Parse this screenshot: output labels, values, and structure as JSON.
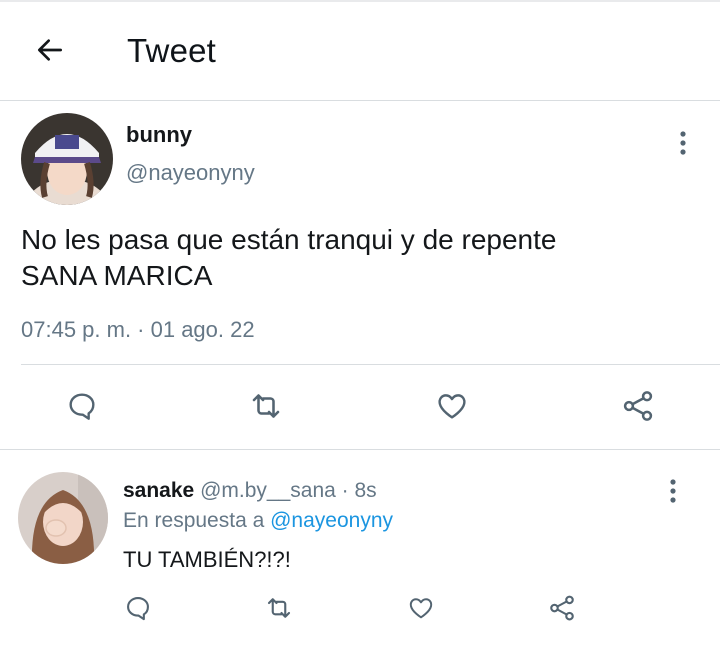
{
  "header": {
    "title": "Tweet"
  },
  "tweet": {
    "name": "bunny",
    "handle": "@nayeonyny",
    "text_line1": "No les pasa que están tranqui y de repente",
    "text_line2": "SANA MARICA",
    "timestamp": "07:45 p. m. · 01 ago. 22"
  },
  "reply": {
    "name": "sanake",
    "handle_time": "@m.by__sana · 8s",
    "in_reply_prefix": "En respuesta a",
    "in_reply_handle": "@nayeonyny",
    "text": "TU TAMBIÉN?!?!"
  },
  "icons": {
    "back": "arrow-left-icon",
    "more": "more-vertical-icon",
    "reply": "comment-icon",
    "retweet": "retweet-icon",
    "like": "heart-icon",
    "share": "share-icon"
  },
  "colors": {
    "text": "#14171a",
    "secondary": "#657786",
    "link": "#1b95e0",
    "icon": "#536471"
  }
}
